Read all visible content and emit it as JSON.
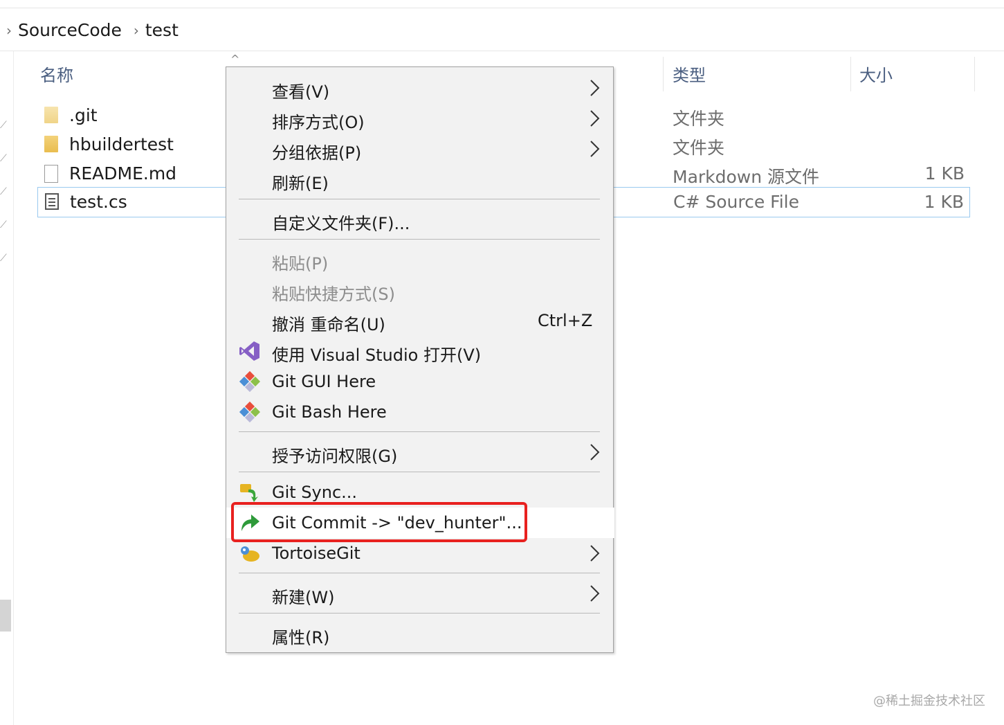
{
  "breadcrumb": {
    "items": [
      "SourceCode",
      "test"
    ]
  },
  "columns": {
    "name": "名称",
    "type": "类型",
    "size": "大小"
  },
  "files": [
    {
      "name": ".git",
      "type": "文件夹",
      "size": "",
      "icon": "folder-icon"
    },
    {
      "name": "hbuildertest",
      "type": "文件夹",
      "size": "",
      "icon": "folder-icon"
    },
    {
      "name": "README.md",
      "type": "Markdown 源文件",
      "size": "1 KB",
      "icon": "file-icon"
    },
    {
      "name": "test.cs",
      "type": "C# Source File",
      "size": "1 KB",
      "icon": "cs-file-icon",
      "selected": true
    }
  ],
  "context_menu": {
    "view": "查看(V)",
    "sort": "排序方式(O)",
    "group": "分组依据(P)",
    "refresh": "刷新(E)",
    "customize": "自定义文件夹(F)...",
    "paste": "粘贴(P)",
    "paste_shortcut": "粘贴快捷方式(S)",
    "undo_rename": "撤消 重命名(U)",
    "undo_shortcut": "Ctrl+Z",
    "open_vs": "使用 Visual Studio 打开(V)",
    "git_gui": "Git GUI Here",
    "git_bash": "Git Bash Here",
    "grant_access": "授予访问权限(G)",
    "git_sync": "Git Sync...",
    "git_commit": "Git Commit -> \"dev_hunter\"...",
    "tortoisegit": "TortoiseGit",
    "new": "新建(W)",
    "properties": "属性(R)"
  },
  "colors": {
    "highlight": "#e8211f",
    "header_text": "#4a5e80",
    "selection_border": "#99c9ef"
  },
  "watermark": "@稀土掘金技术社区"
}
